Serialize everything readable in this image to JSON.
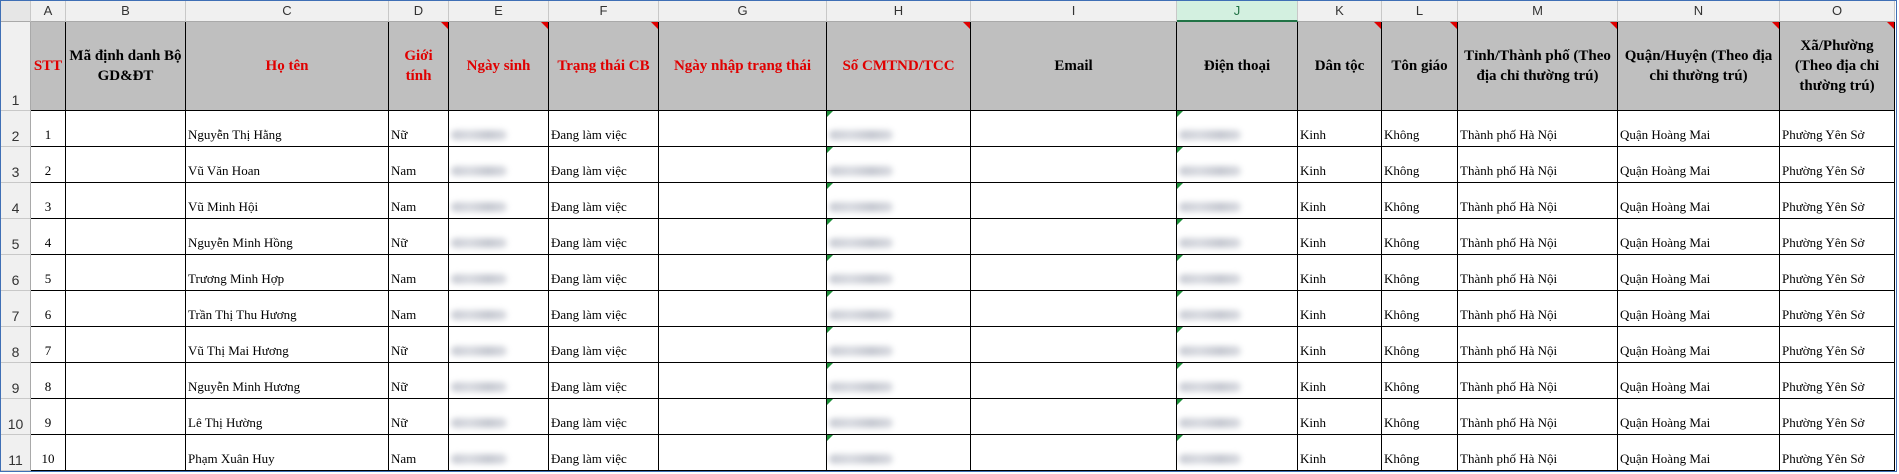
{
  "columns": [
    "A",
    "B",
    "C",
    "D",
    "E",
    "F",
    "G",
    "H",
    "I",
    "J",
    "K",
    "L",
    "M",
    "N",
    "O"
  ],
  "selected_column": "J",
  "header_row_number": "1",
  "headers": [
    {
      "key": "A",
      "text": "STT",
      "color": "red"
    },
    {
      "key": "B",
      "text": "Mã định danh Bộ GD&ĐT",
      "color": "black"
    },
    {
      "key": "C",
      "text": "Họ tên",
      "color": "red"
    },
    {
      "key": "D",
      "text": "Giới tính",
      "color": "red"
    },
    {
      "key": "E",
      "text": "Ngày sinh",
      "color": "red"
    },
    {
      "key": "F",
      "text": "Trạng thái CB",
      "color": "red"
    },
    {
      "key": "G",
      "text": "Ngày nhập trạng thái",
      "color": "red"
    },
    {
      "key": "H",
      "text": "Số CMTND/TCC",
      "color": "red"
    },
    {
      "key": "I",
      "text": "Email",
      "color": "black"
    },
    {
      "key": "J",
      "text": "Điện thoại",
      "color": "black"
    },
    {
      "key": "K",
      "text": "Dân tộc",
      "color": "black"
    },
    {
      "key": "L",
      "text": "Tôn giáo",
      "color": "black"
    },
    {
      "key": "M",
      "text": "Tỉnh/Thành phố (Theo địa chỉ thường trú)",
      "color": "black"
    },
    {
      "key": "N",
      "text": "Quận/Huyện (Theo địa chỉ thường trú)",
      "color": "black"
    },
    {
      "key": "O",
      "text": "Xã/Phường (Theo địa chỉ thường trú)",
      "color": "black"
    }
  ],
  "rows": [
    {
      "row": "2",
      "stt": "1",
      "name": "Nguyễn Thị Hằng",
      "gender": "Nữ",
      "status": "Đang làm việc",
      "ethnic": "Kinh",
      "religion": "Không",
      "province": "Thành phố Hà Nội",
      "district": "Quận Hoàng Mai",
      "ward": "Phường Yên Sở"
    },
    {
      "row": "3",
      "stt": "2",
      "name": "Vũ Văn Hoan",
      "gender": "Nam",
      "status": "Đang làm việc",
      "ethnic": "Kinh",
      "religion": "Không",
      "province": "Thành phố Hà Nội",
      "district": "Quận Hoàng Mai",
      "ward": "Phường Yên Sở"
    },
    {
      "row": "4",
      "stt": "3",
      "name": "Vũ Minh Hội",
      "gender": "Nam",
      "status": "Đang làm việc",
      "ethnic": "Kinh",
      "religion": "Không",
      "province": "Thành phố Hà Nội",
      "district": "Quận Hoàng Mai",
      "ward": "Phường Yên Sở"
    },
    {
      "row": "5",
      "stt": "4",
      "name": "Nguyễn Minh Hồng",
      "gender": "Nữ",
      "status": "Đang làm việc",
      "ethnic": "Kinh",
      "religion": "Không",
      "province": "Thành phố Hà Nội",
      "district": "Quận Hoàng Mai",
      "ward": "Phường Yên Sở"
    },
    {
      "row": "6",
      "stt": "5",
      "name": "Trương Minh Hợp",
      "gender": "Nam",
      "status": "Đang làm việc",
      "ethnic": "Kinh",
      "religion": "Không",
      "province": "Thành phố Hà Nội",
      "district": "Quận Hoàng Mai",
      "ward": "Phường Yên Sở"
    },
    {
      "row": "7",
      "stt": "6",
      "name": "Trần Thị Thu Hương",
      "gender": "Nam",
      "status": "Đang làm việc",
      "ethnic": "Kinh",
      "religion": "Không",
      "province": "Thành phố Hà Nội",
      "district": "Quận Hoàng Mai",
      "ward": "Phường Yên Sở"
    },
    {
      "row": "8",
      "stt": "7",
      "name": "Vũ Thị Mai Hương",
      "gender": "Nữ",
      "status": "Đang làm việc",
      "ethnic": "Kinh",
      "religion": "Không",
      "province": "Thành phố Hà Nội",
      "district": "Quận Hoàng Mai",
      "ward": "Phường Yên Sở"
    },
    {
      "row": "9",
      "stt": "8",
      "name": "Nguyễn Minh Hương",
      "gender": "Nữ",
      "status": "Đang làm việc",
      "ethnic": "Kinh",
      "religion": "Không",
      "province": "Thành phố Hà Nội",
      "district": "Quận Hoàng Mai",
      "ward": "Phường Yên Sở"
    },
    {
      "row": "10",
      "stt": "9",
      "name": "Lê Thị Hường",
      "gender": "Nữ",
      "status": "Đang làm việc",
      "ethnic": "Kinh",
      "religion": "Không",
      "province": "Thành phố Hà Nội",
      "district": "Quận Hoàng Mai",
      "ward": "Phường Yên Sở"
    },
    {
      "row": "11",
      "stt": "10",
      "name": "Phạm Xuân Huy",
      "gender": "Nam",
      "status": "Đang làm việc",
      "ethnic": "Kinh",
      "religion": "Không",
      "province": "Thành phố Hà Nội",
      "district": "Quận Hoàng Mai",
      "ward": "Phường Yên Sở"
    }
  ],
  "colors": {
    "header_bg": "#bfbfbf",
    "header_red": "#e00000",
    "selected_col": "#217346",
    "note_marker": "#e00000",
    "error_marker": "#1e8f3a"
  }
}
